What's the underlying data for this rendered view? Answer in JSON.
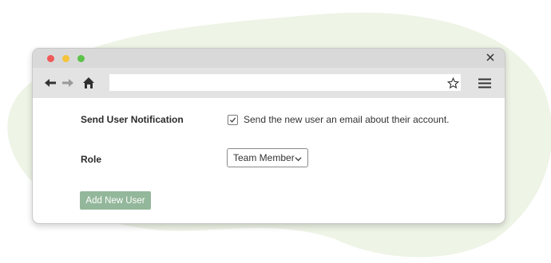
{
  "colors": {
    "background_blob": "#eef4e6",
    "button_bg": "#93b79a",
    "titlebar": "#d9d9d9",
    "toolbar": "#e3e3e3"
  },
  "browser": {
    "icons": {
      "close": "close-icon",
      "back": "arrow-left-icon",
      "forward": "arrow-right-icon",
      "home": "home-icon",
      "bookmark": "star-icon",
      "menu": "hamburger-menu-icon"
    },
    "url": ""
  },
  "form": {
    "notification_label": "Send User Notification",
    "notification_checkbox_checked": true,
    "notification_text": "Send the new user an email about their account.",
    "role_label": "Role",
    "role_selected": "Team Member",
    "submit_label": "Add New User"
  }
}
